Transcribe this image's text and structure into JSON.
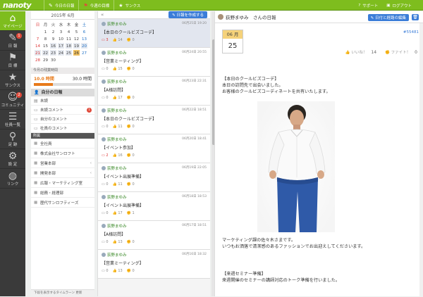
{
  "app": {
    "logo": "nanoty"
  },
  "topnav": [
    {
      "icon": "pencil-icon",
      "glyph": "✎",
      "label": "今日の日報"
    },
    {
      "icon": "flag-icon",
      "glyph": "⚑",
      "label": "今週の目標"
    },
    {
      "icon": "star-icon",
      "glyph": "★",
      "label": "サンクス"
    }
  ],
  "topright": [
    {
      "icon": "help-icon",
      "glyph": "?",
      "label": "サポート"
    },
    {
      "icon": "lock-icon",
      "glyph": "🔒",
      "label": "ログアウト"
    }
  ],
  "sidebar": [
    {
      "icon": "home-icon",
      "glyph": "⌂",
      "label": "マイページ",
      "active": true,
      "badge": ""
    },
    {
      "icon": "pencil-icon",
      "glyph": "✎",
      "label": "日 報",
      "active": false,
      "badge": "1"
    },
    {
      "icon": "flag-icon",
      "glyph": "⚑",
      "label": "目 標",
      "active": false,
      "badge": ""
    },
    {
      "icon": "star-icon",
      "glyph": "★",
      "label": "サンクス",
      "active": false,
      "badge": ""
    },
    {
      "icon": "people-icon",
      "glyph": "☺",
      "label": "コミュニティ",
      "active": false,
      "badge": "2"
    },
    {
      "icon": "list-icon",
      "glyph": "☰",
      "label": "社員一覧",
      "active": false,
      "badge": ""
    },
    {
      "icon": "footprints-icon",
      "glyph": "⚲",
      "label": "足 跡",
      "active": false,
      "badge": ""
    },
    {
      "icon": "gear-icon",
      "glyph": "⚙",
      "label": "設 定",
      "active": false,
      "badge": ""
    },
    {
      "icon": "globe-icon",
      "glyph": "◍",
      "label": "リンク",
      "active": false,
      "badge": ""
    }
  ],
  "calendar": {
    "title": "2015年 6月",
    "weekdays": [
      "日",
      "月",
      "火",
      "水",
      "木",
      "金",
      "土"
    ],
    "days": [
      "",
      "1",
      "2",
      "3",
      "4",
      "5",
      "6",
      "7",
      "8",
      "9",
      "10",
      "11",
      "12",
      "13",
      "14",
      "15",
      "16",
      "17",
      "18",
      "19",
      "20",
      "21",
      "22",
      "23",
      "24",
      "25",
      "26",
      "27",
      "28",
      "29",
      "30",
      "",
      "",
      "",
      ""
    ]
  },
  "time_panel": {
    "title": "今月の残業時間",
    "actual": "10.0 時間",
    "limit": "30.0 時間",
    "progress": 0.33
  },
  "menu": {
    "header": "自分の日報",
    "items": [
      {
        "icon": "doc-icon",
        "glyph": "▤",
        "label": "未読",
        "badge": ""
      },
      {
        "icon": "comment-icon",
        "glyph": "▭",
        "label": "未読コメント",
        "badge": "1"
      },
      {
        "icon": "comment-icon",
        "glyph": "▭",
        "label": "自分のコメント",
        "badge": ""
      },
      {
        "icon": "comment-icon",
        "glyph": "▭",
        "label": "社員のコメント",
        "badge": ""
      }
    ]
  },
  "departments": {
    "header": "所属",
    "items": [
      {
        "label": "全社員",
        "chev": false
      },
      {
        "label": "株式会社サンロフト",
        "chev": false
      },
      {
        "label": "営業本部",
        "chev": true
      },
      {
        "label": "開発本部",
        "chev": true
      },
      {
        "label": "広報・マーケティング室",
        "chev": false
      },
      {
        "label": "総務・経理部",
        "chev": false
      },
      {
        "label": "歴代サンロフティーズ",
        "chev": false
      }
    ],
    "footer": "下段を表示するタイムラーン 更新"
  },
  "list": {
    "collapse": "«",
    "create_label": "日報を作成する",
    "entries": [
      {
        "author": "荻野まゆみ",
        "date": "06月25日 19:20",
        "title": "【本日のクールビズコーデ】",
        "comments": "3",
        "likes": "14",
        "fans": "0",
        "selected": true,
        "comment_red": true
      },
      {
        "author": "荻野まゆみ",
        "date": "06月24日 20:55",
        "title": "【営業ミーティング】",
        "comments": "0",
        "likes": "15",
        "fans": "0",
        "selected": false,
        "comment_red": false
      },
      {
        "author": "荻野まゆみ",
        "date": "06月23日 22:31",
        "title": "【A様訪問】",
        "comments": "0",
        "likes": "17",
        "fans": "0",
        "selected": false,
        "comment_red": false
      },
      {
        "author": "荻野まゆみ",
        "date": "06月22日 18:51",
        "title": "【本日のクールビズコーデ】",
        "comments": "0",
        "likes": "11",
        "fans": "0",
        "selected": false,
        "comment_red": false
      },
      {
        "author": "荻野まゆみ",
        "date": "06月20日 18:41",
        "title": "【イベント参加】",
        "comments": "2",
        "likes": "16",
        "fans": "0",
        "selected": false,
        "comment_red": true
      },
      {
        "author": "荻野まゆみ",
        "date": "06月19日 22:05",
        "title": "【イベント出展準備】",
        "comments": "0",
        "likes": "11",
        "fans": "0",
        "selected": false,
        "comment_red": false
      },
      {
        "author": "荻野まゆみ",
        "date": "06月18日 18:53",
        "title": "【イベント出展準備】",
        "comments": "0",
        "likes": "17",
        "fans": "1",
        "selected": false,
        "comment_red": false
      },
      {
        "author": "荻野まゆみ",
        "date": "06月17日 18:51",
        "title": "【A様訪問】",
        "comments": "0",
        "likes": "13",
        "fans": "0",
        "selected": false,
        "comment_red": false
      },
      {
        "author": "荻野まゆみ",
        "date": "06月16日 18:32",
        "title": "【営業ミーティング】",
        "comments": "0",
        "likes": "13",
        "fans": "0",
        "selected": false,
        "comment_red": false
      }
    ]
  },
  "detail": {
    "header_name": "荻野まゆみ　さんの日報",
    "edit_label": "日付と経路の編集",
    "month": "06 月",
    "day": "25",
    "post_id": "#55481",
    "likes_label": "いいね！",
    "likes_count": "14",
    "fans_label": "ファイト！",
    "fans_count": "0",
    "section1_title": "【本日のクールビズコーデ】",
    "section1_lines": [
      "本日の訪問先で出会いました。",
      "お客様のクールビズコーディネートを共有いたします。"
    ],
    "section2_lines": [
      "マーケティング課の佐々木さまです。",
      "いつもお洒落で清潔感のあるファッションでお出迎えしてくださいます。"
    ],
    "section3_title": "【来週セミナー準備】",
    "section3_lines": [
      "来週開催のセミナーの講師対応のトーク準備を行いました。"
    ]
  }
}
